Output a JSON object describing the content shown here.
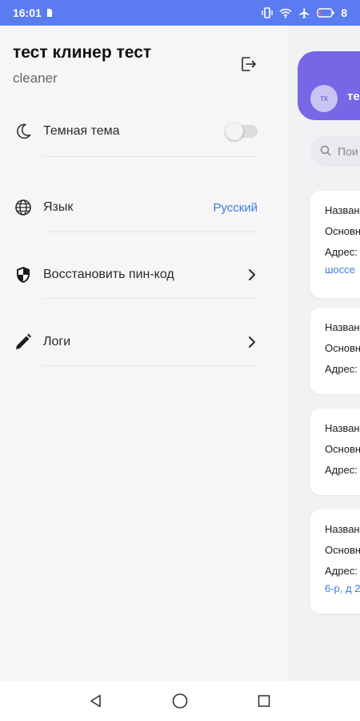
{
  "status_bar": {
    "time": "16:01",
    "battery_level": "8",
    "icons": [
      "sd-card-icon",
      "vibrate-icon",
      "wifi-icon",
      "airplane-icon",
      "battery-icon"
    ]
  },
  "drawer": {
    "profile": {
      "name": "тест клинер тест",
      "role": "cleaner"
    },
    "menu": {
      "dark_theme": {
        "label": "Темная тема",
        "enabled": false
      },
      "language": {
        "label": "Язык",
        "value": "Русский"
      },
      "restore_pin": {
        "label": "Восстановить пин-код"
      },
      "logs": {
        "label": "Логи"
      }
    }
  },
  "background_screen": {
    "avatar_initials": "тк",
    "user_name_partial": "те",
    "search_placeholder_partial": "Пои",
    "cards": [
      {
        "name_label": "Назван",
        "main_label": "Основн",
        "address_label": "Адрес:",
        "address_continuation": "шоссе"
      },
      {
        "name_label": "Назван",
        "main_label": "Основн",
        "address_label": "Адрес:"
      },
      {
        "name_label": "Назван",
        "main_label": "Основн",
        "address_label": "Адрес:"
      },
      {
        "name_label": "Назван",
        "main_label": "Основн",
        "address_label": "Адрес:",
        "address_continuation": "6-р, д 2"
      }
    ]
  },
  "colors": {
    "status_bar": "#5b7cf0",
    "header_accent": "#7567e6",
    "link_blue": "#3d7be0",
    "background": "#f6f6f8"
  }
}
